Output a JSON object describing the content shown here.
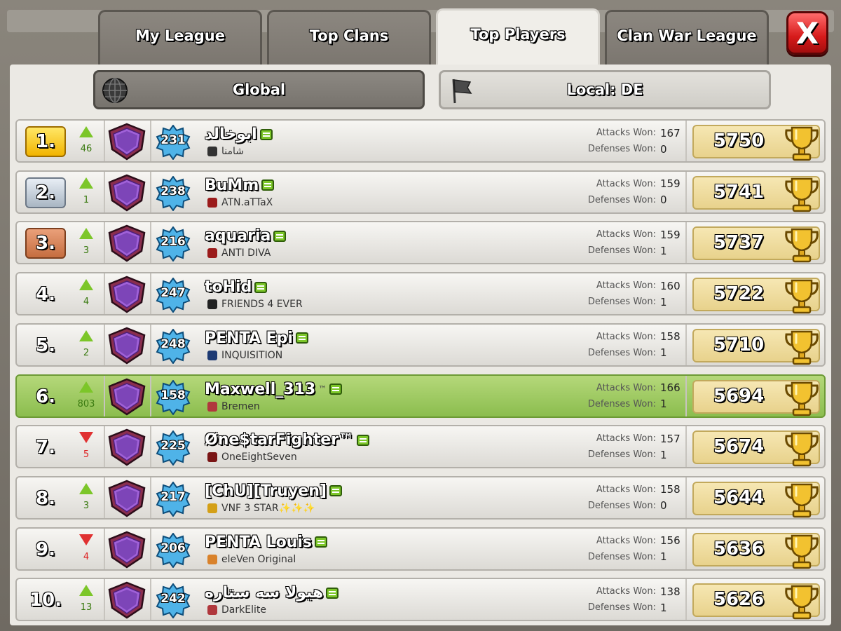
{
  "tabs": [
    {
      "label": "My League"
    },
    {
      "label": "Top Clans"
    },
    {
      "label": "Top Players",
      "active": true
    },
    {
      "label": "Clan War League"
    }
  ],
  "close_label": "X",
  "filters": {
    "global": "Global",
    "local": "Local: DE"
  },
  "stats_labels": {
    "attacks": "Attacks Won:",
    "defenses": "Defenses Won:"
  },
  "players": [
    {
      "rank": "1.",
      "medal": "gold",
      "dir": "up",
      "delta": "46",
      "level": "231",
      "name": "ابوخالد",
      "clan": "شامنا",
      "clan_color": "#333333",
      "attacks": "167",
      "defenses": "0",
      "trophies": "5750"
    },
    {
      "rank": "2.",
      "medal": "silver",
      "dir": "up",
      "delta": "1",
      "level": "238",
      "name": "BuMm",
      "clan": "ATN.aTTaX",
      "clan_color": "#9b1b1b",
      "attacks": "159",
      "defenses": "0",
      "trophies": "5741"
    },
    {
      "rank": "3.",
      "medal": "bronze",
      "dir": "up",
      "delta": "3",
      "level": "216",
      "name": "aquaria",
      "clan": "ANTI DIVA",
      "clan_color": "#9b1b1b",
      "attacks": "159",
      "defenses": "1",
      "trophies": "5737"
    },
    {
      "rank": "4.",
      "medal": "",
      "dir": "up",
      "delta": "4",
      "level": "247",
      "name": "toHid",
      "clan": "FRIENDS 4 EVER",
      "clan_color": "#222222",
      "attacks": "160",
      "defenses": "1",
      "trophies": "5722"
    },
    {
      "rank": "5.",
      "medal": "",
      "dir": "up",
      "delta": "2",
      "level": "248",
      "name": "PENTA Epi",
      "clan": "INQUISITION",
      "clan_color": "#1d3a73",
      "attacks": "158",
      "defenses": "1",
      "trophies": "5710"
    },
    {
      "rank": "6.",
      "medal": "",
      "dir": "up",
      "delta": "803",
      "level": "158",
      "name": "Maxwell_313",
      "tm": "™",
      "clan": "Bremen",
      "clan_color": "#b0383d",
      "attacks": "166",
      "defenses": "1",
      "trophies": "5694",
      "me": true
    },
    {
      "rank": "7.",
      "medal": "",
      "dir": "down",
      "delta": "5",
      "level": "225",
      "name": "Øne$tarFighter™",
      "clan": "OneEightSeven",
      "clan_color": "#7a1515",
      "attacks": "157",
      "defenses": "1",
      "trophies": "5674"
    },
    {
      "rank": "8.",
      "medal": "",
      "dir": "up",
      "delta": "3",
      "level": "217",
      "name": "[ChU][Truyen]",
      "clan": "VNF 3 STAR✨✨✨",
      "clan_color": "#d4a017",
      "attacks": "158",
      "defenses": "0",
      "trophies": "5644"
    },
    {
      "rank": "9.",
      "medal": "",
      "dir": "down",
      "delta": "4",
      "level": "206",
      "name": "PENTA Louis",
      "clan": "eleVen Original",
      "clan_color": "#d9822b",
      "attacks": "156",
      "defenses": "1",
      "trophies": "5636"
    },
    {
      "rank": "10.",
      "medal": "",
      "dir": "up",
      "delta": "13",
      "level": "242",
      "name": "هيولا سه ستاره",
      "clan": "DarkElite",
      "clan_color": "#b0383d",
      "attacks": "138",
      "defenses": "1",
      "trophies": "5626"
    }
  ]
}
